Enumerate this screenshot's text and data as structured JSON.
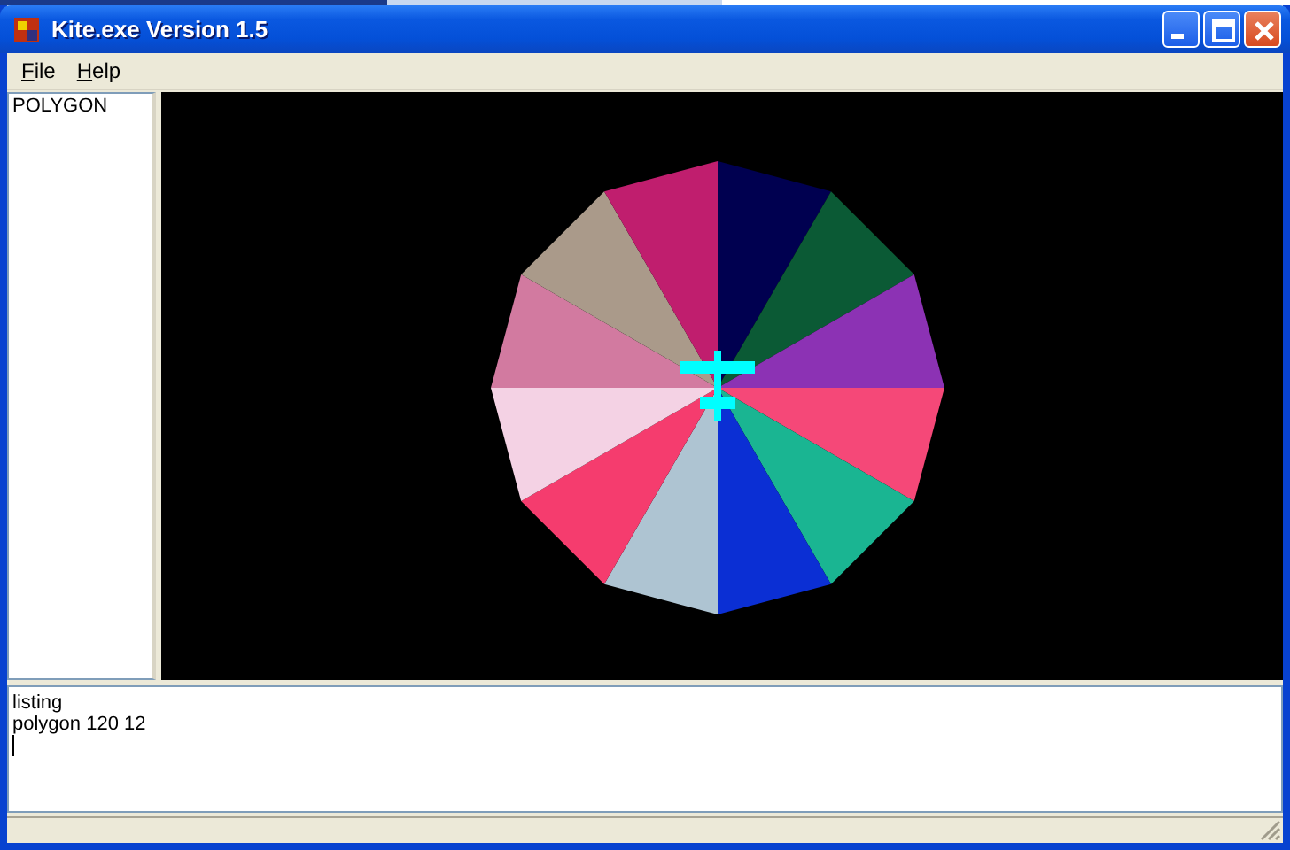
{
  "window": {
    "title": "Kite.exe Version 1.5"
  },
  "menu": [
    {
      "label": "File"
    },
    {
      "label": "Help"
    }
  ],
  "procedures": [
    "POLYGON"
  ],
  "canvas": {
    "slices": [
      {
        "color": "#000050"
      },
      {
        "color": "#0b5a35"
      },
      {
        "color": "#8c32b4"
      },
      {
        "color": "#f54878"
      },
      {
        "color": "#1ab592"
      },
      {
        "color": "#0b2fd4"
      },
      {
        "color": "#aec4d2"
      },
      {
        "color": "#f53c6e"
      },
      {
        "color": "#f4d2e4"
      },
      {
        "color": "#d27aa0"
      },
      {
        "color": "#aa9a8a"
      },
      {
        "color": "#c01e6e"
      }
    ]
  },
  "console": {
    "lines": [
      "listing",
      "polygon 120 12"
    ]
  }
}
